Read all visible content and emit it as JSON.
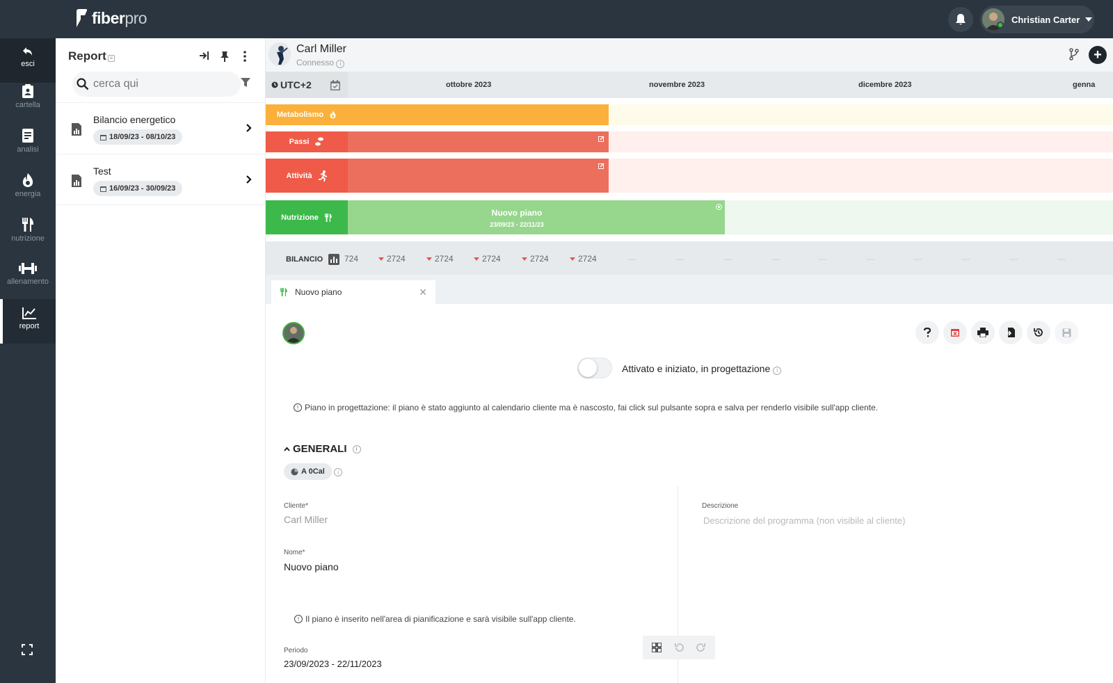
{
  "app": {
    "brand_bold": "fiber",
    "brand_light": "pro",
    "user_name": "Christian Carter"
  },
  "rail": {
    "items": [
      {
        "label": "esci",
        "icon": "reply-icon"
      },
      {
        "label": "cartella",
        "icon": "clipboard-icon"
      },
      {
        "label": "analisi",
        "icon": "document-icon"
      },
      {
        "label": "energia",
        "icon": "flame-icon"
      },
      {
        "label": "nutrizione",
        "icon": "cutlery-icon"
      },
      {
        "label": "allenamento",
        "icon": "dumbbell-icon"
      },
      {
        "label": "report",
        "icon": "chart-line-icon"
      }
    ]
  },
  "panel": {
    "title": "Report",
    "search_placeholder": "cerca qui",
    "reports": [
      {
        "name": "Bilancio energetico",
        "dates": "18/09/23 - 08/10/23"
      },
      {
        "name": "Test",
        "dates": "16/09/23 - 30/09/23"
      }
    ]
  },
  "client": {
    "name": "Carl Miller",
    "status": "Connesso"
  },
  "timeline": {
    "timezone": "UTC+2",
    "months": [
      "ottobre 2023",
      "novembre 2023",
      "dicembre 2023",
      "genna"
    ],
    "lanes": [
      {
        "label": "Metabolismo",
        "icon": "flame-icon",
        "color": "#fbb03b"
      },
      {
        "label": "Passi",
        "icon": "footsteps-icon",
        "color": "#f05a48"
      },
      {
        "label": "Attività",
        "icon": "running-icon",
        "color": "#f05a48"
      },
      {
        "label": "Nutrizione",
        "icon": "cutlery-icon",
        "color": "#3cb94a"
      }
    ],
    "nutrition_plan": {
      "title": "Nuovo piano",
      "dates": "23/09/23 - 22/11/23"
    },
    "balance": {
      "label": "BILANCIO",
      "values": [
        "724",
        "2724",
        "2724",
        "2724",
        "2724",
        "2724"
      ],
      "dashes": [
        "—",
        "—",
        "—",
        "—",
        "—",
        "—",
        "—",
        "—",
        "—",
        "—"
      ]
    }
  },
  "tab": {
    "label": "Nuovo piano"
  },
  "form": {
    "toggle_label": "Attivato e iniziato, in progettazione",
    "design_note": "Piano in progettazione: il piano è stato aggiunto al calendario cliente ma è nascosto, fai click sul pulsante sopra e salva per renderlo visibile sull'app cliente.",
    "section_title": "GENERALI",
    "kcal_badge": "A 0Cal",
    "client_label": "Cliente*",
    "client_value": "Carl Miller",
    "name_label": "Nome*",
    "name_value": "Nuovo piano",
    "desc_label": "Descrizione",
    "desc_placeholder": "Descrizione del programma (non visibile al cliente)",
    "plan_note": "Il piano è inserito nell'area di pianificazione e sarà visibile sull'app cliente.",
    "period_label": "Periodo",
    "period_value": "23/09/2023 - 22/11/2023"
  }
}
